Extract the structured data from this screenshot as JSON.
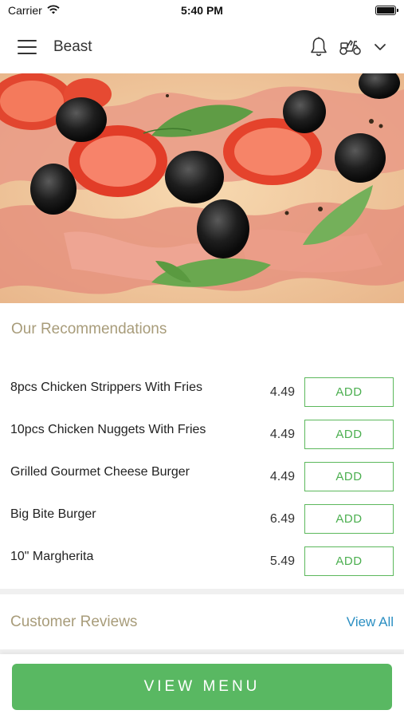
{
  "status_bar": {
    "carrier": "Carrier",
    "time": "5:40 PM",
    "battery_level": 1.0
  },
  "header": {
    "store_name": "Beast",
    "icons": [
      "menu-icon",
      "bell-icon",
      "delivery-scooter-icon",
      "chevron-down-icon"
    ]
  },
  "hero": {
    "image": "pizza-photo"
  },
  "recommendations": {
    "title": "Our Recommendations",
    "items": [
      {
        "name": "8pcs Chicken Strippers With Fries",
        "price": "4.49",
        "button": "ADD"
      },
      {
        "name": "10pcs Chicken Nuggets With Fries",
        "price": "4.49",
        "button": "ADD"
      },
      {
        "name": "Grilled Gourmet Cheese Burger",
        "price": "4.49",
        "button": "ADD"
      },
      {
        "name": "Big Bite Burger",
        "price": "6.49",
        "button": "ADD"
      },
      {
        "name": "10\" Margherita",
        "price": "5.49",
        "button": "ADD"
      }
    ]
  },
  "reviews": {
    "title": "Customer Reviews",
    "view_all": "View All"
  },
  "bottom": {
    "view_menu": "VIEW MENU"
  },
  "colors": {
    "accent_green": "#59b862",
    "section_title": "#a89c7a",
    "link_blue": "#2b8fc2"
  }
}
